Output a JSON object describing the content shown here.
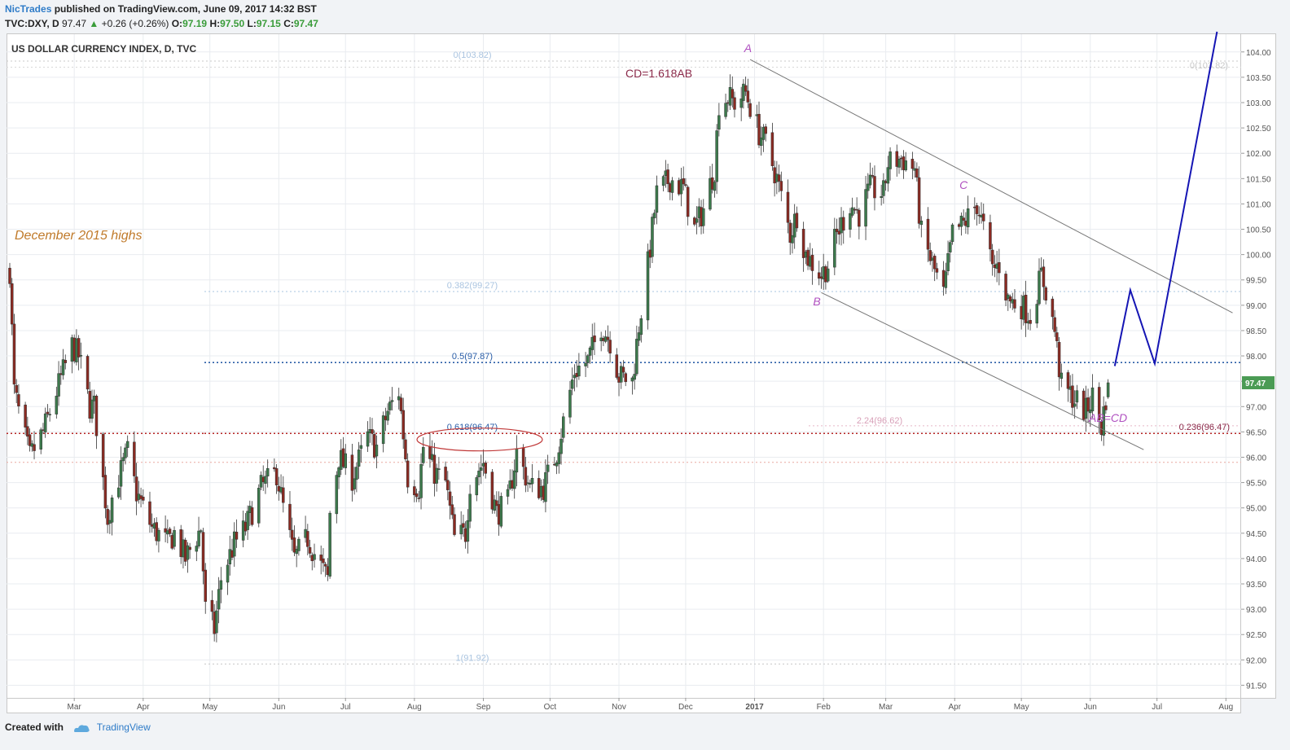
{
  "header": {
    "author": "NicTrades",
    "published": "published on TradingView.com, June 09, 2017 14:32 BST",
    "symbol": "TVC:DXY, D",
    "last": "97.47",
    "change": "+0.26 (+0.26%)",
    "o_label": "O:",
    "o_value": "97.19",
    "h_label": "H:",
    "h_value": "97.50",
    "l_label": "L:",
    "l_value": "97.15",
    "c_label": "C:",
    "c_value": "97.47",
    "up_arrow": "▲"
  },
  "footer": {
    "created_with": "Created with",
    "brand": "TradingView",
    "brand_icon": "tradingview-cloud-icon"
  },
  "colors": {
    "bull": "#3c7a4c",
    "bear": "#8b2a22",
    "fib_light": "#aac4e0",
    "fib_mid": "#2a5ea8",
    "fib_red": "#b52424",
    "projection": "#1515b4",
    "channel": "#777777",
    "pattern_label": "#b050c0",
    "last_price_badge": "#4b9b54",
    "annotation_orange": "#c07a2a",
    "annotation_cd": "#8b2a4a"
  },
  "chart_data": {
    "type": "candlestick",
    "title": "US DOLLAR CURRENCY INDEX, D, TVC",
    "interval": "D",
    "ylim": [
      91.25,
      104.35
    ],
    "y_ticks": [
      "91.50",
      "92.00",
      "92.50",
      "93.00",
      "93.50",
      "94.00",
      "94.50",
      "95.00",
      "95.50",
      "96.00",
      "96.50",
      "97.00",
      "97.50",
      "98.00",
      "98.50",
      "99.00",
      "99.50",
      "100.00",
      "100.50",
      "101.00",
      "101.50",
      "102.00",
      "102.50",
      "103.00",
      "103.50",
      "104.00"
    ],
    "x_ticks": [
      {
        "label": "Mar",
        "date": "2016-03-01"
      },
      {
        "label": "Apr",
        "date": "2016-04-01"
      },
      {
        "label": "May",
        "date": "2016-05-01"
      },
      {
        "label": "Jun",
        "date": "2016-06-01"
      },
      {
        "label": "Jul",
        "date": "2016-07-01"
      },
      {
        "label": "Aug",
        "date": "2016-08-01"
      },
      {
        "label": "Sep",
        "date": "2016-09-01"
      },
      {
        "label": "Oct",
        "date": "2016-10-01"
      },
      {
        "label": "Nov",
        "date": "2016-11-01"
      },
      {
        "label": "Dec",
        "date": "2016-12-01"
      },
      {
        "label": "2017",
        "date": "2017-01-01",
        "bold": true
      },
      {
        "label": "Feb",
        "date": "2017-02-01"
      },
      {
        "label": "Mar",
        "date": "2017-03-01"
      },
      {
        "label": "Apr",
        "date": "2017-04-01"
      },
      {
        "label": "May",
        "date": "2017-05-01"
      },
      {
        "label": "Jun",
        "date": "2017-06-01"
      },
      {
        "label": "Jul",
        "date": "2017-07-01"
      },
      {
        "label": "Aug",
        "date": "2017-08-01"
      }
    ],
    "close_path": [
      [
        "2016-02-01",
        99.7
      ],
      [
        "2016-02-03",
        97.3
      ],
      [
        "2016-02-05",
        96.9
      ],
      [
        "2016-02-10",
        96.0
      ],
      [
        "2016-02-16",
        96.5
      ],
      [
        "2016-02-22",
        97.3
      ],
      [
        "2016-02-29",
        98.2
      ],
      [
        "2016-03-03",
        98.0
      ],
      [
        "2016-03-08",
        97.0
      ],
      [
        "2016-03-10",
        97.0
      ],
      [
        "2016-03-16",
        94.8
      ],
      [
        "2016-03-18",
        95.2
      ],
      [
        "2016-03-21",
        95.6
      ],
      [
        "2016-03-25",
        96.1
      ],
      [
        "2016-03-29",
        95.3
      ],
      [
        "2016-04-05",
        94.6
      ],
      [
        "2016-04-12",
        94.3
      ],
      [
        "2016-04-15",
        94.5
      ],
      [
        "2016-04-20",
        94.0
      ],
      [
        "2016-04-27",
        94.6
      ],
      [
        "2016-04-29",
        93.0
      ],
      [
        "2016-05-03",
        92.6
      ],
      [
        "2016-05-06",
        93.6
      ],
      [
        "2016-05-12",
        94.3
      ],
      [
        "2016-05-17",
        94.6
      ],
      [
        "2016-05-24",
        95.4
      ],
      [
        "2016-05-31",
        95.7
      ],
      [
        "2016-06-03",
        95.0
      ],
      [
        "2016-06-08",
        94.0
      ],
      [
        "2016-06-14",
        94.4
      ],
      [
        "2016-06-17",
        94.1
      ],
      [
        "2016-06-23",
        93.6
      ],
      [
        "2016-06-24",
        94.9
      ],
      [
        "2016-06-28",
        96.0
      ],
      [
        "2016-07-04",
        95.6
      ],
      [
        "2016-07-11",
        96.4
      ],
      [
        "2016-07-15",
        96.2
      ],
      [
        "2016-07-20",
        96.9
      ],
      [
        "2016-07-25",
        97.3
      ],
      [
        "2016-07-29",
        95.6
      ],
      [
        "2016-08-03",
        95.4
      ],
      [
        "2016-08-05",
        96.2
      ],
      [
        "2016-08-10",
        95.7
      ],
      [
        "2016-08-15",
        95.5
      ],
      [
        "2016-08-19",
        94.4
      ],
      [
        "2016-08-24",
        94.5
      ],
      [
        "2016-08-26",
        95.5
      ],
      [
        "2016-09-01",
        95.9
      ],
      [
        "2016-09-07",
        94.9
      ],
      [
        "2016-09-12",
        95.1
      ],
      [
        "2016-09-16",
        96.1
      ],
      [
        "2016-09-22",
        95.4
      ],
      [
        "2016-09-28",
        95.4
      ],
      [
        "2016-10-04",
        96.1
      ],
      [
        "2016-10-07",
        96.7
      ],
      [
        "2016-10-12",
        97.7
      ],
      [
        "2016-10-18",
        97.9
      ],
      [
        "2016-10-24",
        98.6
      ],
      [
        "2016-10-28",
        98.3
      ],
      [
        "2016-11-01",
        97.6
      ],
      [
        "2016-11-07",
        97.5
      ],
      [
        "2016-11-10",
        98.6
      ],
      [
        "2016-11-14",
        99.8
      ],
      [
        "2016-11-18",
        101.2
      ],
      [
        "2016-11-24",
        101.5
      ],
      [
        "2016-11-30",
        101.3
      ],
      [
        "2016-12-05",
        100.5
      ],
      [
        "2016-12-09",
        100.9
      ],
      [
        "2016-12-14",
        101.7
      ],
      [
        "2016-12-16",
        103.0
      ],
      [
        "2016-12-20",
        103.1
      ],
      [
        "2016-12-23",
        103.0
      ],
      [
        "2016-12-28",
        103.2
      ],
      [
        "2017-01-03",
        102.4
      ],
      [
        "2017-01-06",
        102.2
      ],
      [
        "2017-01-11",
        101.5
      ],
      [
        "2017-01-17",
        100.4
      ],
      [
        "2017-01-20",
        100.8
      ],
      [
        "2017-01-24",
        100.0
      ],
      [
        "2017-01-31",
        99.6
      ],
      [
        "2017-02-03",
        99.8
      ],
      [
        "2017-02-07",
        100.4
      ],
      [
        "2017-02-13",
        101.0
      ],
      [
        "2017-02-17",
        100.8
      ],
      [
        "2017-02-22",
        101.3
      ],
      [
        "2017-02-28",
        101.2
      ],
      [
        "2017-03-02",
        101.8
      ],
      [
        "2017-03-08",
        101.9
      ],
      [
        "2017-03-14",
        101.7
      ],
      [
        "2017-03-17",
        100.4
      ],
      [
        "2017-03-22",
        99.8
      ],
      [
        "2017-03-27",
        99.2
      ],
      [
        "2017-03-31",
        100.4
      ],
      [
        "2017-04-05",
        100.6
      ],
      [
        "2017-04-11",
        101.0
      ],
      [
        "2017-04-14",
        100.5
      ],
      [
        "2017-04-18",
        99.7
      ],
      [
        "2017-04-21",
        99.8
      ],
      [
        "2017-04-25",
        99.1
      ],
      [
        "2017-05-01",
        99.0
      ],
      [
        "2017-05-05",
        98.8
      ],
      [
        "2017-05-10",
        99.6
      ],
      [
        "2017-05-12",
        99.3
      ],
      [
        "2017-05-16",
        98.5
      ],
      [
        "2017-05-19",
        97.4
      ],
      [
        "2017-05-24",
        97.2
      ],
      [
        "2017-05-30",
        96.9
      ],
      [
        "2017-06-02",
        97.2
      ],
      [
        "2017-06-06",
        96.6
      ],
      [
        "2017-06-09",
        97.47
      ]
    ],
    "candle_seed": 7,
    "fib_levels": [
      {
        "ratio": "0",
        "value": 103.82,
        "label": "0(103.82)"
      },
      {
        "ratio": "0.382",
        "value": 99.27,
        "label": "0.382(99.27)"
      },
      {
        "ratio": "0.5",
        "value": 97.87,
        "label": "0.5(97.87)"
      },
      {
        "ratio": "0.618",
        "value": 96.47,
        "label": "0.618(96.47)"
      },
      {
        "ratio": "1",
        "value": 91.92,
        "label": "1(91.92)"
      }
    ],
    "fib_right": [
      {
        "value": 103.82,
        "label": "0(103.82)"
      },
      {
        "value": 96.47,
        "label": "0.236(96.47)"
      }
    ],
    "ext_level": {
      "value": 96.62,
      "label": "2.24(96.62)"
    },
    "dec2015_high": {
      "value": 95.9
    },
    "channel_upper": [
      [
        "2016-12-30",
        103.85
      ],
      [
        "2017-08-04",
        98.85
      ]
    ],
    "channel_lower": [
      [
        "2017-01-31",
        99.25
      ],
      [
        "2017-06-25",
        96.15
      ]
    ],
    "projection": [
      [
        "2017-06-12",
        97.8
      ],
      [
        "2017-06-19",
        99.3
      ],
      [
        "2017-06-30",
        97.85
      ],
      [
        "2017-07-28",
        104.4
      ]
    ],
    "pattern_points": [
      {
        "label": "A",
        "date": "2016-12-29",
        "value": 104.0
      },
      {
        "label": "B",
        "date": "2017-01-29",
        "value": 99.0
      },
      {
        "label": "C",
        "date": "2017-04-05",
        "value": 101.3
      }
    ],
    "annotations": {
      "dec2015": "December 2015 highs",
      "cd_ratio": "CD=1.618AB",
      "ab_cd": "AB=CD"
    },
    "last_price": "97.47"
  }
}
